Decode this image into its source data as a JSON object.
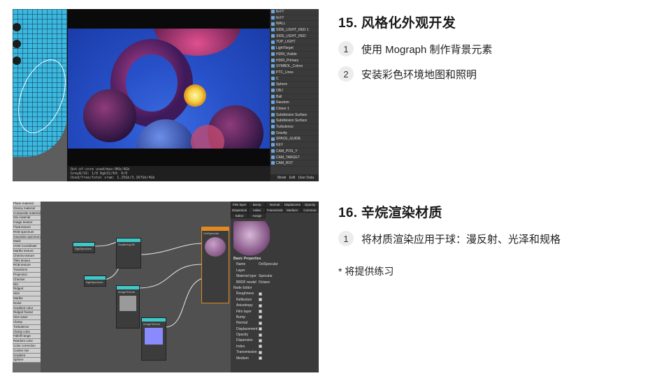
{
  "sections": [
    {
      "title": "15. 风格化外观开发",
      "items": [
        {
          "num": "1",
          "text": "使用 Mograph 制作背景元素"
        },
        {
          "num": "2",
          "text": "安装彩色环境地图和照明"
        }
      ]
    },
    {
      "title": "16. 辛烷渲染材质",
      "items": [
        {
          "num": "1",
          "text": "将材质渲染应用于球：漫反射、光泽和规格"
        }
      ],
      "note": "* 将提供练习"
    }
  ],
  "shot1": {
    "tree_items": [
      "N-FT",
      "N-FT",
      "WALL",
      "SIDE_LIGHT_RED 1",
      "SIDE_LIGHT_RED",
      "TOP_LIGHT",
      "LightTarget",
      "HDRI_Visible",
      "HDRI_Primary",
      "SYMBOL_Colors",
      "PTC_Lines",
      "C",
      "Sphere",
      "OBJ",
      "Ball",
      "Random",
      "Cloner 1",
      "Subdivision Surface",
      "Subdivision Surface",
      "Turbulence",
      "Gravity",
      "SPACE_GUIDE",
      "KEY",
      "CAM_POS_Y",
      "CAM_TARGET",
      "CAM_ROT"
    ],
    "tree_bar": [
      "Mode",
      "Edit",
      "User Data"
    ],
    "status_lines": [
      "Out-of-core used/max:0Kb/4Gb",
      "Grey8/16: 1/0     Rgb32/64: 0/0",
      "Used/free/total vram: 1.25Gb/3.167Gb/4Gb"
    ]
  },
  "shot2": {
    "list_items": [
      "Plane material",
      "Glossy material",
      "Composite material",
      "Mix material",
      "Image texture",
      "Float texture",
      "RGB spectrum",
      "Gaussian spectrum",
      "Mask",
      "UVW Coordinate",
      "Marble texture",
      "Checks texture",
      "Tiles texture",
      "RGB texture",
      "Transform",
      "Projection",
      "Checker",
      "Dirt",
      "Ridged",
      "Sine",
      "Marble",
      "Noise",
      "Gradient color",
      "Ridged fractal",
      "Sine wave",
      "Clamp",
      "Turbulence",
      "Clamp color",
      "Falloff range",
      "Random color",
      "Color correction",
      "Cosine mix",
      "Gradient",
      "Sphere"
    ],
    "tabs": [
      "Film layer",
      "Bump",
      "Normal",
      "Displacement",
      "Opacity",
      "Dispersion",
      "Index",
      "Transmission",
      "Medium",
      "Common",
      "Editor",
      "Assign"
    ],
    "panel_title": "Basic Properties",
    "name_label": "Name",
    "name_value": "OctSpecular",
    "layer_label": "Layer",
    "material_type_label": "Material type",
    "material_type_value": "Specular",
    "brdf_label": "BRDF model",
    "brdf_value": "Octane",
    "node_editor": "Node Editor",
    "channels": [
      "Roughness",
      "Reflection",
      "Anisotropy",
      "Film layer",
      "Bump",
      "Normal",
      "Displacement",
      "Opacity",
      "Dispersion",
      "Index",
      "Transmission",
      "Medium"
    ],
    "nodes": [
      {
        "title": "RgbSpectrum",
        "rows": [
          "Color"
        ]
      },
      {
        "title": "Scattering Mt",
        "rows": [
          "Density",
          "Ray length",
          "Absorption",
          "Invert Absorption",
          "Scattering",
          "Emission"
        ]
      },
      {
        "title": "RgbSpectrum",
        "rows": [
          "Color"
        ]
      },
      {
        "title": "ImageTexture",
        "rows": [
          "Power",
          "Gamma",
          "Invert",
          "Transform",
          "Projection"
        ]
      },
      {
        "title": "ImageTexture",
        "rows": [
          "Power",
          "Gamma",
          "Invert",
          "Transform",
          "Projection"
        ]
      },
      {
        "title": "OctSpecular",
        "rows": [
          "Roughness",
          "Reflection",
          "Anisotropy",
          "Film layer",
          "Film width",
          "Bump",
          "Normal",
          "Displacement",
          "Opacity",
          "Transmission",
          "Emission",
          "Medium"
        ]
      }
    ]
  },
  "colors": {
    "badge_bg": "#ececec",
    "node_head": "#3fc8c8",
    "viewport_blue": "#2750c8"
  }
}
